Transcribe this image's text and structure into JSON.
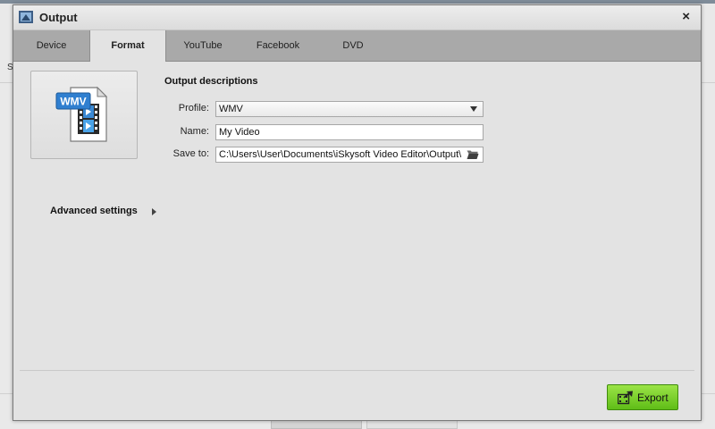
{
  "background": {
    "left_letter": "S"
  },
  "dialog": {
    "title": "Output",
    "close_glyph": "×"
  },
  "tabs": [
    {
      "label": "Device",
      "active": false
    },
    {
      "label": "Format",
      "active": true
    },
    {
      "label": "YouTube",
      "active": false
    },
    {
      "label": "Facebook",
      "active": false
    },
    {
      "label": "DVD",
      "active": false
    }
  ],
  "preview": {
    "format_badge": "WMV",
    "icon": "wmv-file-icon"
  },
  "output": {
    "section_title": "Output descriptions",
    "profile_label": "Profile:",
    "profile_value": "WMV",
    "name_label": "Name:",
    "name_value": "My Video",
    "save_to_label": "Save to:",
    "save_to_value": "C:\\Users\\User\\Documents\\iSkysoft Video Editor\\Output\\"
  },
  "advanced": {
    "label": "Advanced settings"
  },
  "export": {
    "label": "Export",
    "color": "#6cc822"
  },
  "colors": {
    "tabbar": "#a9a9a9",
    "dialog_bg": "#e3e3e3",
    "accent_green": "#6cc822"
  }
}
